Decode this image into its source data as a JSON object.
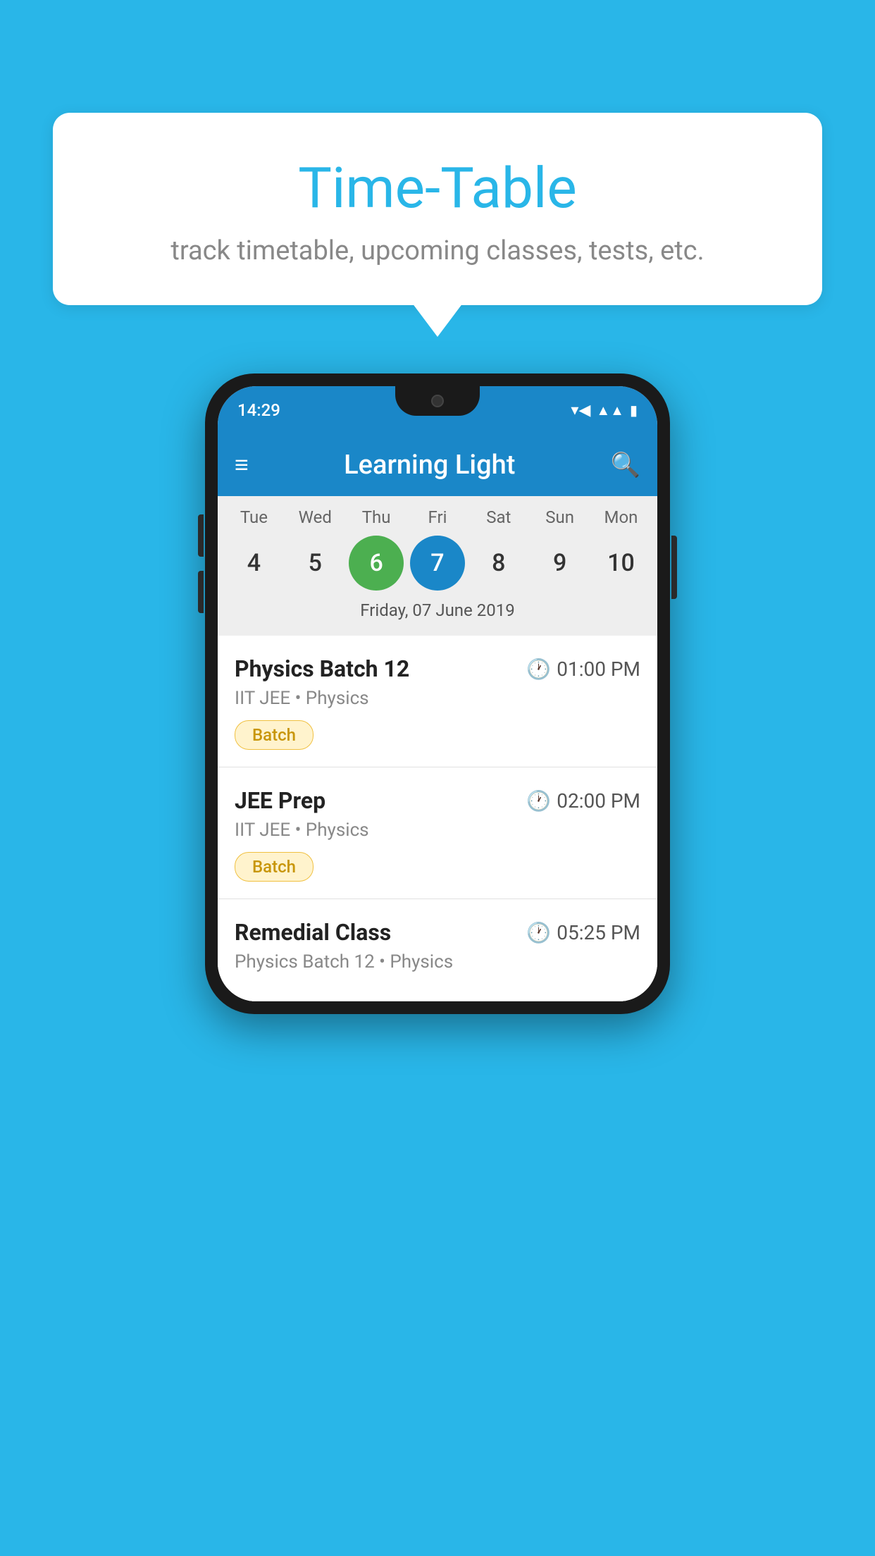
{
  "background_color": "#29b6e8",
  "bubble": {
    "title": "Time-Table",
    "subtitle": "track timetable, upcoming classes, tests, etc."
  },
  "phone": {
    "status_bar": {
      "time": "14:29"
    },
    "app_bar": {
      "title": "Learning Light"
    },
    "calendar": {
      "days": [
        {
          "label": "Tue",
          "num": "4"
        },
        {
          "label": "Wed",
          "num": "5"
        },
        {
          "label": "Thu",
          "num": "6",
          "state": "today"
        },
        {
          "label": "Fri",
          "num": "7",
          "state": "selected"
        },
        {
          "label": "Sat",
          "num": "8"
        },
        {
          "label": "Sun",
          "num": "9"
        },
        {
          "label": "Mon",
          "num": "10"
        }
      ],
      "selected_date": "Friday, 07 June 2019"
    },
    "schedule": [
      {
        "name": "Physics Batch 12",
        "time": "01:00 PM",
        "meta": "IIT JEE • Physics",
        "badge": "Batch"
      },
      {
        "name": "JEE Prep",
        "time": "02:00 PM",
        "meta": "IIT JEE • Physics",
        "badge": "Batch"
      },
      {
        "name": "Remedial Class",
        "time": "05:25 PM",
        "meta": "Physics Batch 12 • Physics",
        "badge": ""
      }
    ]
  }
}
